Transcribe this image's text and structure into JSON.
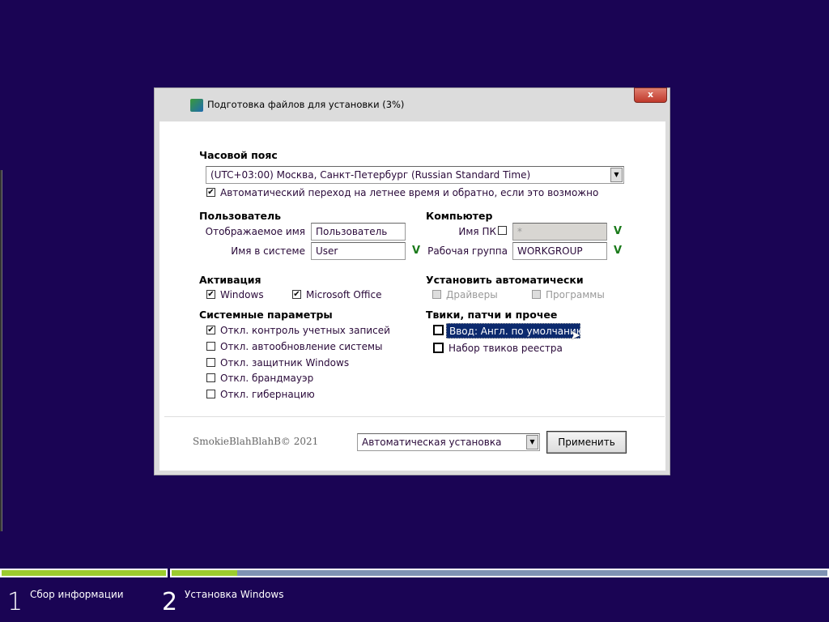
{
  "dialog": {
    "title": "Подготовка файлов для установки (3%)",
    "close": "x"
  },
  "timezone": {
    "heading": "Часовой пояс",
    "value": "(UTC+03:00) Москва, Санкт-Петербург (Russian Standard Time)",
    "dst_label": "Автоматический переход на летнее время и обратно, если это возможно",
    "dst_checked": true
  },
  "user": {
    "heading": "Пользователь",
    "display_name_label": "Отображаемое имя",
    "display_name_value": "Пользователь",
    "login_label": "Имя в системе",
    "login_value": "User",
    "login_ok": "V"
  },
  "computer": {
    "heading": "Компьютер",
    "pc_name_label": "Имя ПК",
    "pc_name_value": "*",
    "pc_name_ok": "V",
    "workgroup_label": "Рабочая группа",
    "workgroup_value": "WORKGROUP",
    "workgroup_ok": "V"
  },
  "activation": {
    "heading": "Активация",
    "windows": "Windows",
    "office": "Microsoft Office"
  },
  "auto_install": {
    "heading": "Установить автоматически",
    "drivers": "Драйверы",
    "programs": "Программы"
  },
  "system": {
    "heading": "Системные параметры",
    "items": [
      "Откл. контроль учетных записей",
      "Откл. автообновление системы",
      "Откл. защитник Windows",
      "Откл. брандмауэр",
      "Откл. гибернацию"
    ]
  },
  "tweaks": {
    "heading": "Твики, патчи и прочее",
    "items": [
      "Ввод: Англ. по умолчанию",
      "Набор твиков реестра"
    ]
  },
  "footer": {
    "copyright": "SmokieBlahBlahB© 2021",
    "mode": "Автоматическая установка",
    "apply": "Применить"
  },
  "steps": [
    {
      "num": "1",
      "label": "Сбор информации",
      "progress": 1.0
    },
    {
      "num": "2",
      "label": "Установка Windows",
      "progress": 0.1
    }
  ],
  "colors": {
    "background": "#1a0454",
    "progress_fill": "#9ccc2e",
    "progress_track": "#7f93b3"
  }
}
